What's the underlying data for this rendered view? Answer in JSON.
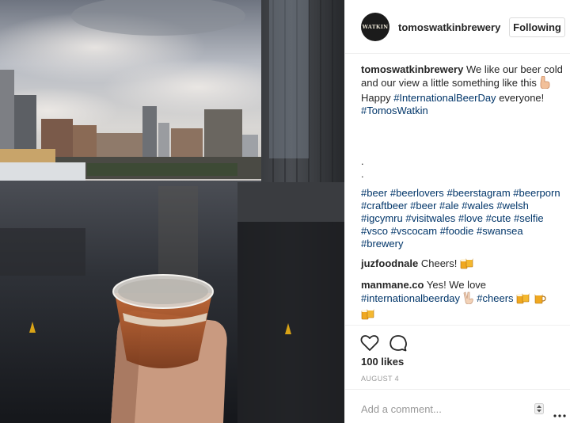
{
  "post": {
    "username": "tomoswatkinbrewery",
    "avatar_text": "WATKIN",
    "follow_label": "Following",
    "caption": {
      "username": "tomoswatkinbrewery",
      "text_1": "We like our beer cold and our view a little something like this",
      "text_2": "Happy",
      "tag_1": "#InternationalBeerDay",
      "text_3": "everyone!",
      "tag_2": "#TomosWatkin",
      "dot_1": ".",
      "dot_2": ".",
      "hashtags": [
        "#beer",
        "#beerlovers",
        "#beerstagram",
        "#beerporn",
        "#craftbeer",
        "#beer",
        "#ale",
        "#wales",
        "#welsh",
        "#igcymru",
        "#visitwales",
        "#love",
        "#cute",
        "#selfie",
        "#vsco",
        "#vscocam",
        "#foodie",
        "#swansea",
        "#brewery"
      ]
    },
    "comments": [
      {
        "username": "juzfoodnale",
        "text": "Cheers!"
      },
      {
        "username": "manmane.co",
        "text": "Yes! We love",
        "tag_1": "#internationalbeerday",
        "tag_2": "#cheers"
      }
    ],
    "likes": "100 likes",
    "date": "AUGUST 4",
    "add_comment_placeholder": "Add a comment...",
    "icons": {
      "like": "heart-icon",
      "comment": "comment-bubble-icon",
      "more": "more-dots-icon",
      "beer_emoji": "beer-mugs-emoji",
      "point_emoji": "pointing-hand-emoji",
      "victory_emoji": "victory-hand-emoji"
    }
  }
}
